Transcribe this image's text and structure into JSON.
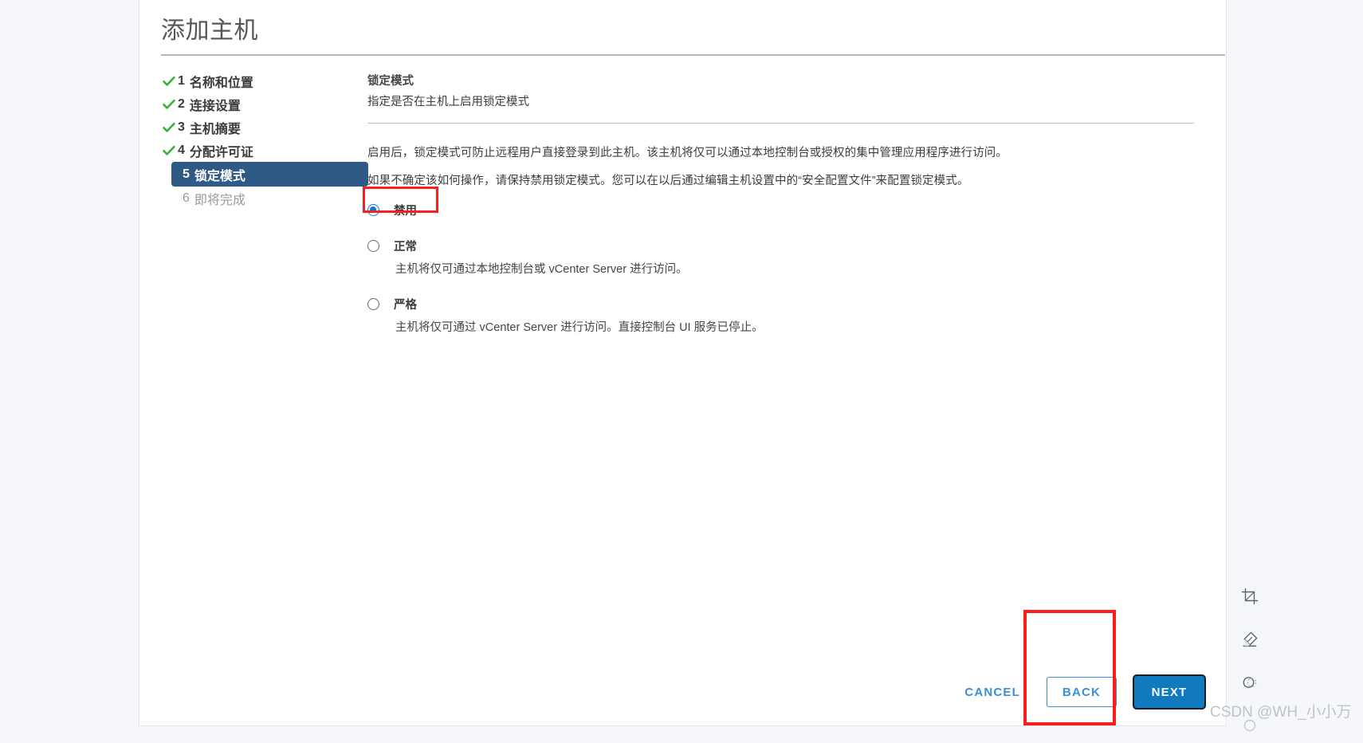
{
  "window": {
    "title": "添加主机",
    "background_color": "#f5f7fa",
    "panel_color": "#ffffff"
  },
  "steps": [
    {
      "number": "1",
      "label": "名称和位置",
      "state": "done",
      "icon": "check-icon"
    },
    {
      "number": "2",
      "label": "连接设置",
      "state": "done",
      "icon": "check-icon"
    },
    {
      "number": "3",
      "label": "主机摘要",
      "state": "done",
      "icon": "check-icon"
    },
    {
      "number": "4",
      "label": "分配许可证",
      "state": "done",
      "icon": "check-icon"
    },
    {
      "number": "5",
      "label": "锁定模式",
      "state": "active",
      "icon": ""
    },
    {
      "number": "6",
      "label": "即将完成",
      "state": "future",
      "icon": ""
    }
  ],
  "content": {
    "heading": "锁定模式",
    "subheading": "指定是否在主机上启用锁定模式",
    "paragraph_1": "启用后，锁定模式可防止远程用户直接登录到此主机。该主机将仅可以通过本地控制台或授权的集中管理应用程序进行访问。",
    "paragraph_2": "如果不确定该如何操作，请保持禁用锁定模式。您可以在以后通过编辑主机设置中的“安全配置文件”来配置锁定模式。"
  },
  "lockdown_options": [
    {
      "id": "disabled",
      "label": "禁用",
      "description": "",
      "selected": true
    },
    {
      "id": "normal",
      "label": "正常",
      "description": "主机将仅可通过本地控制台或 vCenter Server 进行访问。",
      "selected": false
    },
    {
      "id": "strict",
      "label": "严格",
      "description": "主机将仅可通过 vCenter Server 进行访问。直接控制台 UI 服务已停止。",
      "selected": false
    }
  ],
  "footer": {
    "cancel_label": "CANCEL",
    "back_label": "BACK",
    "next_label": "NEXT"
  },
  "annotations": {
    "highlight_color": "#fb1d1d",
    "disabled_option_box": "禁用",
    "next_button_box": "NEXT"
  },
  "editor_toolbar": [
    {
      "name": "crop-icon"
    },
    {
      "name": "eraser-icon"
    },
    {
      "name": "shape-icon"
    },
    {
      "name": "partial-icon"
    }
  ],
  "watermark": {
    "text": "CSDN @WH_小小万"
  },
  "colors": {
    "accent_blue": "#0f7bbe",
    "link_blue": "#3b8edb",
    "active_step_bg": "#2e5a85",
    "check_green": "#3cb03c",
    "radio_blue": "#0f77d8"
  }
}
